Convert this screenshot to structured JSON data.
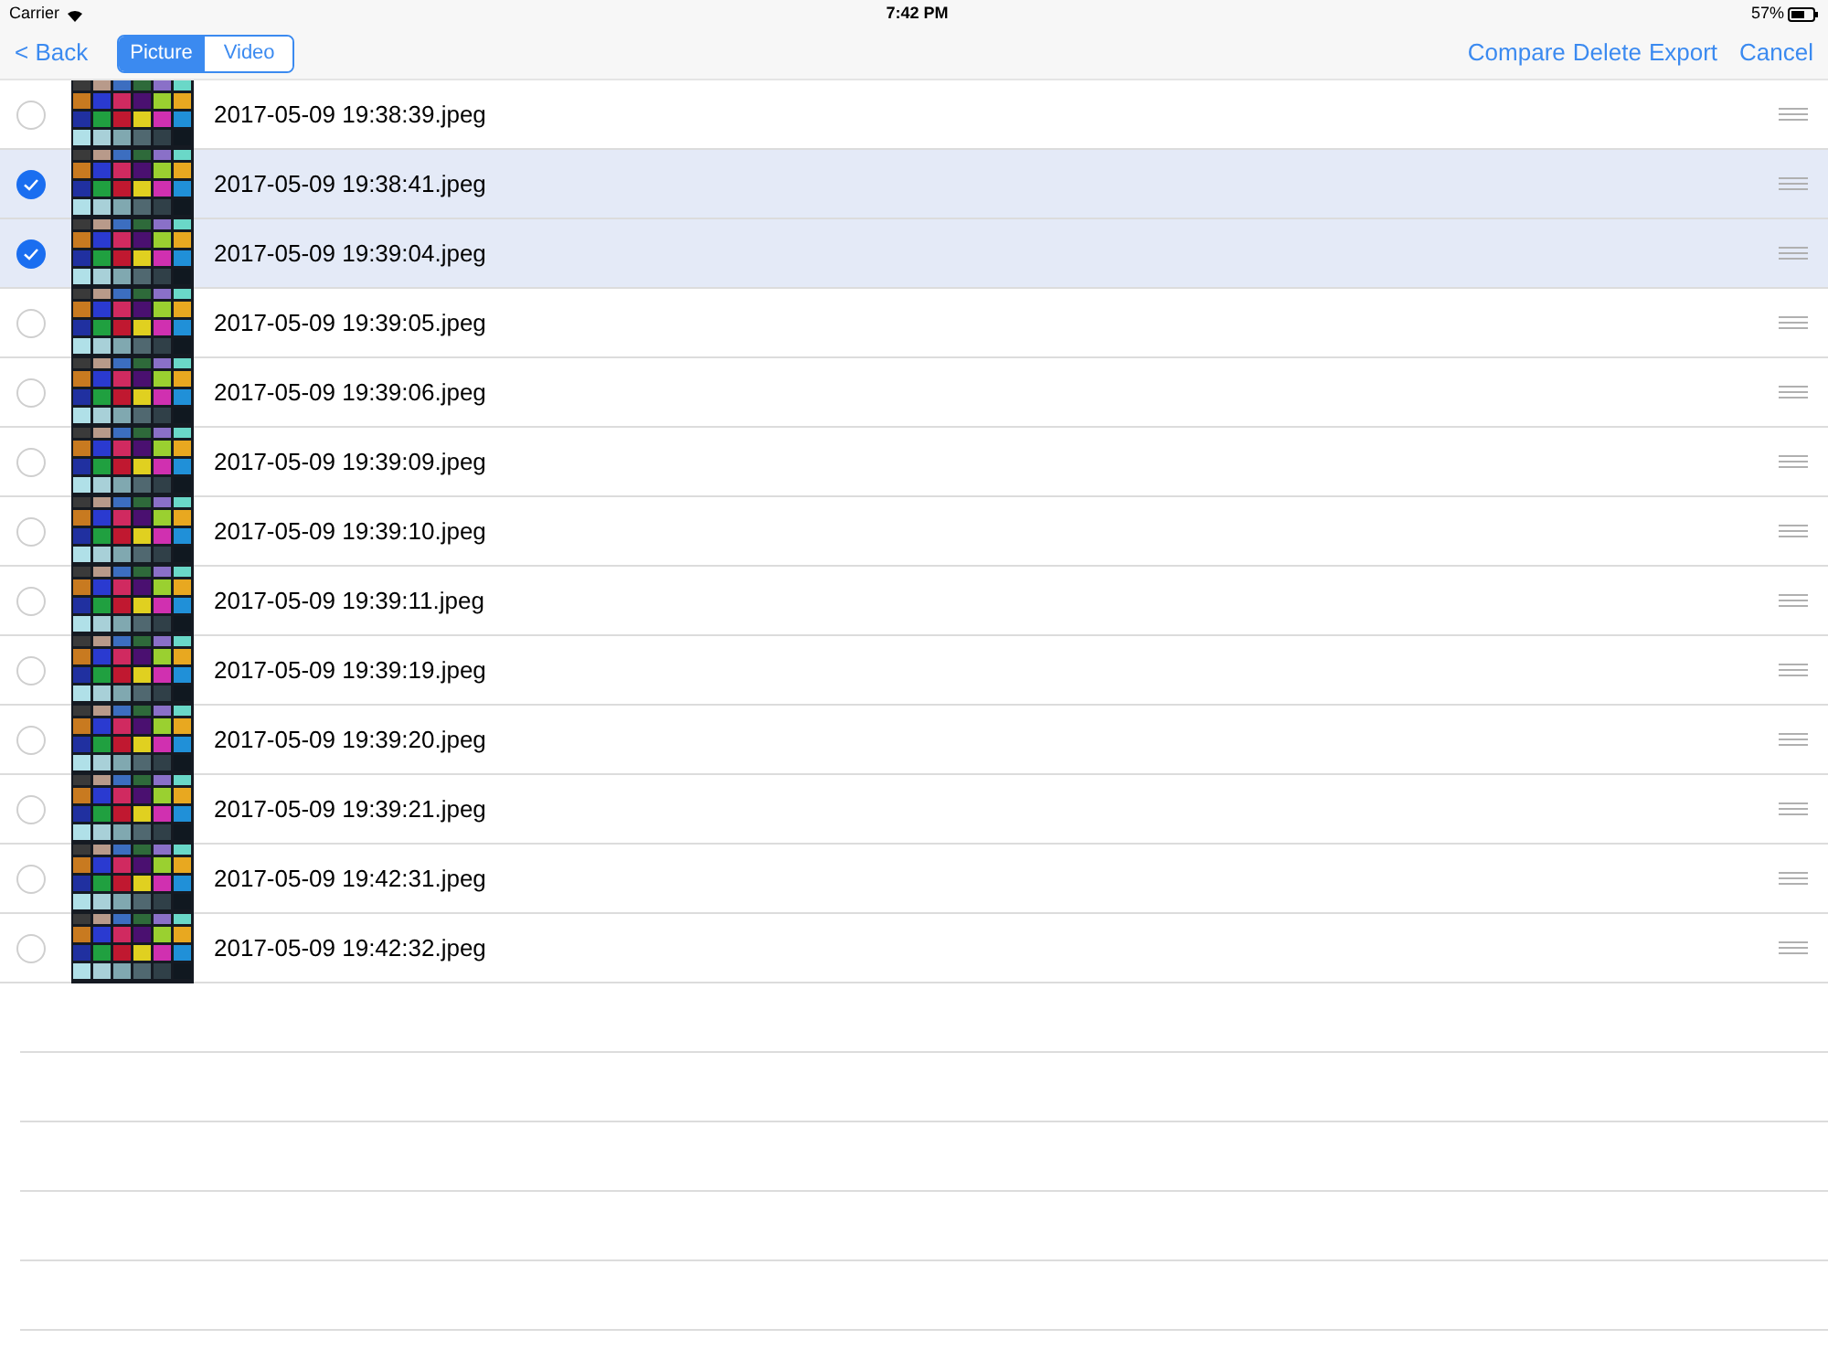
{
  "status_bar": {
    "carrier": "Carrier",
    "time": "7:42 PM",
    "battery": "57%"
  },
  "nav_bar": {
    "back": "< Back",
    "segments": [
      {
        "label": "Picture",
        "selected": true
      },
      {
        "label": "Video",
        "selected": false
      }
    ],
    "actions": [
      "Compare",
      "Delete",
      "Export"
    ],
    "cancel": "Cancel"
  },
  "rows": [
    {
      "name": "2017-05-09 19:38:39.jpeg",
      "selected": false
    },
    {
      "name": "2017-05-09 19:38:41.jpeg",
      "selected": true
    },
    {
      "name": "2017-05-09 19:39:04.jpeg",
      "selected": true
    },
    {
      "name": "2017-05-09 19:39:05.jpeg",
      "selected": false
    },
    {
      "name": "2017-05-09 19:39:06.jpeg",
      "selected": false
    },
    {
      "name": "2017-05-09 19:39:09.jpeg",
      "selected": false
    },
    {
      "name": "2017-05-09 19:39:10.jpeg",
      "selected": false
    },
    {
      "name": "2017-05-09 19:39:11.jpeg",
      "selected": false
    },
    {
      "name": "2017-05-09 19:39:19.jpeg",
      "selected": false
    },
    {
      "name": "2017-05-09 19:39:20.jpeg",
      "selected": false
    },
    {
      "name": "2017-05-09 19:39:21.jpeg",
      "selected": false
    },
    {
      "name": "2017-05-09 19:42:31.jpeg",
      "selected": false
    },
    {
      "name": "2017-05-09 19:42:32.jpeg",
      "selected": false
    }
  ]
}
